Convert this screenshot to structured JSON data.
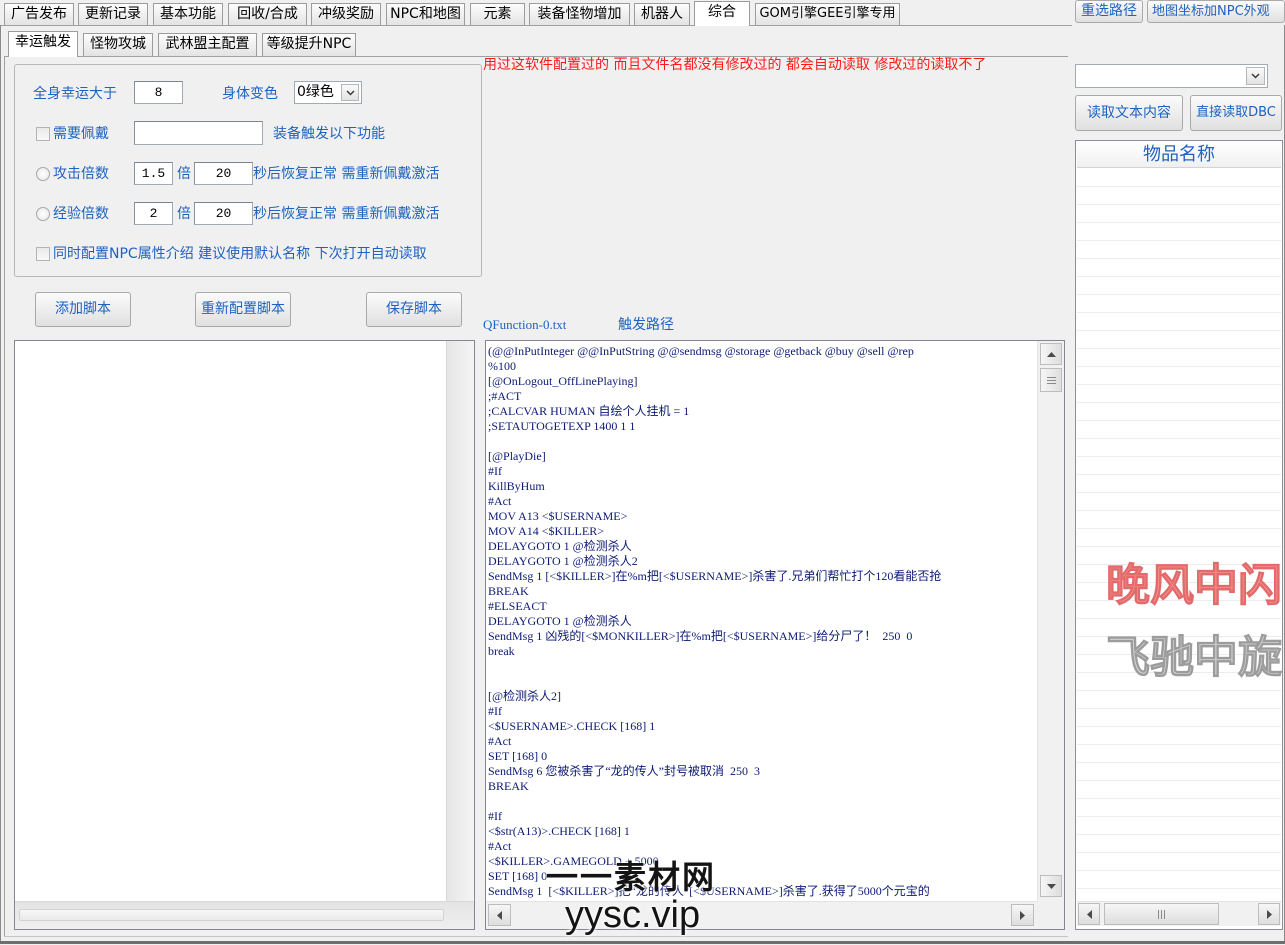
{
  "top_tabs": [
    {
      "label": "广告发布",
      "selected": false
    },
    {
      "label": "更新记录",
      "selected": false
    },
    {
      "label": "基本功能",
      "selected": false
    },
    {
      "label": "回收/合成",
      "selected": false
    },
    {
      "label": "冲级奖励",
      "selected": false
    },
    {
      "label": "NPC和地图",
      "selected": false
    },
    {
      "label": "元素",
      "selected": false
    },
    {
      "label": "装备怪物增加",
      "selected": false
    },
    {
      "label": "机器人",
      "selected": false
    },
    {
      "label": "综合",
      "selected": true
    },
    {
      "label": "GOM引擎GEE引擎专用",
      "selected": false
    }
  ],
  "top_buttons": {
    "reselect_path": "重选路径",
    "map_coords_npc": "地图坐标加NPC外观"
  },
  "sub_tabs": [
    {
      "label": "幸运触发",
      "selected": true
    },
    {
      "label": "怪物攻城",
      "selected": false
    },
    {
      "label": "武林盟主配置",
      "selected": false
    },
    {
      "label": "等级提升NPC",
      "selected": false
    }
  ],
  "notice": "用过这软件配置过的 而且文件名都没有修改过的 都会自动读取 修改过的读取不了",
  "luck_trigger": {
    "luck_label": "全身幸运大于",
    "luck_value": "8",
    "body_color_label": "身体变色",
    "body_color_value": "0绿色",
    "require_wear": {
      "label": "需要佩戴",
      "checked": false,
      "value": ""
    },
    "equip_trigger_label": "装备触发以下功能",
    "attack": {
      "label": "攻击倍数",
      "selected": false,
      "multiplier": "1.5",
      "seconds": "20"
    },
    "exp": {
      "label": "经验倍数",
      "selected": false,
      "multiplier": "2",
      "seconds": "20"
    },
    "times_label": "倍",
    "restore_label": "秒后恢复正常 需重新佩戴激活",
    "npc_intro": {
      "label": "同时配置NPC属性介绍 建议使用默认名称 下次打开自动读取",
      "checked": false
    }
  },
  "actions": {
    "add_script": "添加脚本",
    "reconfigure_script": "重新配置脚本",
    "save_script": "保存脚本"
  },
  "editor": {
    "file_name": "QFunction-0.txt",
    "path_label": "触发路径",
    "script_text": "(@@InPutInteger @@InPutString @@sendmsg @storage @getback @buy @sell @rep\n%100\n[@OnLogout_OffLinePlaying]\n;#ACT\n;CALCVAR HUMAN 自绘个人挂机 = 1\n;SETAUTOGETEXP 1400 1 1\n\n[@PlayDie]\n#If\nKillByHum\n#Act\nMOV A13 <$USERNAME>\nMOV A14 <$KILLER>\nDELAYGOTO 1 @检测杀人\nDELAYGOTO 1 @检测杀人2\nSendMsg 1 [<$KILLER>]在%m把[<$USERNAME>]杀害了.兄弟们帮忙打个120看能否抢\nBREAK\n#ELSEACT\nDELAYGOTO 1 @检测杀人\nSendMsg 1 凶残的[<$MONKILLER>]在%m把[<$USERNAME>]给分尸了！  250  0\nbreak\n\n\n[@检测杀人2]\n#If\n<$USERNAME>.CHECK [168] 1\n#Act\nSET [168] 0\nSendMsg 6 您被杀害了“龙的传人”封号被取消  250  3\nBREAK\n\n#If\n<$str(A13)>.CHECK [168] 1\n#Act\n<$KILLER>.GAMEGOLD + 5000\nSET [168] 0\nSendMsg 1  [<$KILLER>]把“龙的传人”[<$USERNAME>]杀害了.获得了5000个元宝的"
  },
  "right_panel": {
    "read_text_button": "读取文本内容",
    "read_dbc_button": "直接读取DBC",
    "list_header": "物品名称"
  },
  "overlay_text": {
    "line1": "晚风中闪",
    "line2": "飞驰中旋"
  },
  "watermark": {
    "line1": "一一素材网",
    "line2": "yysc.vip"
  },
  "colors": {
    "label_blue": "#1e62c0",
    "notice_red": "#ff1a1a",
    "script_navy": "#0c1a73"
  },
  "icons": [
    "chevron-down-icon",
    "scroll-up-icon",
    "scroll-down-icon",
    "scroll-left-icon",
    "scroll-right-icon"
  ]
}
